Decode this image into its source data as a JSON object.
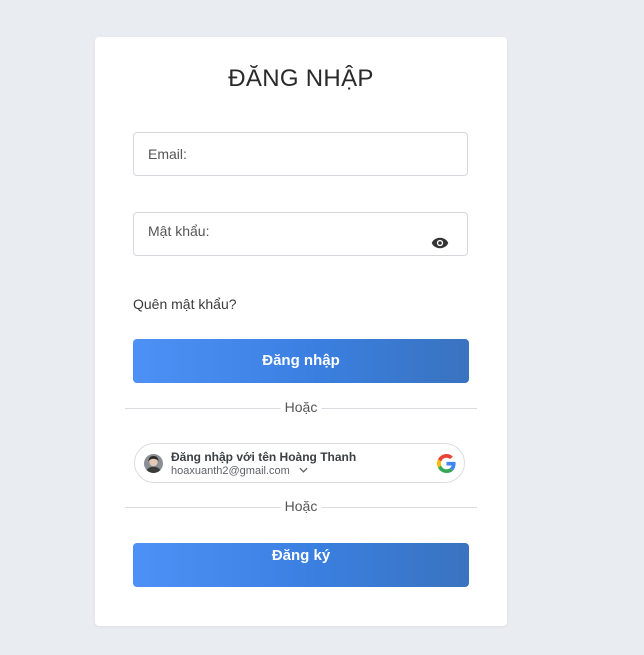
{
  "login": {
    "title": "ĐĂNG NHẬP",
    "email_placeholder": "Email:",
    "password_placeholder": "Mật khẩu:",
    "forgot_label": "Quên mật khẩu?",
    "login_button": "Đăng nhập",
    "or_label_1": "Hoặc",
    "or_label_2": "Hoặc",
    "register_button": "Đăng ký",
    "icons": {
      "password_toggle": "eye-icon",
      "google": "google-logo-icon",
      "avatar": "user-avatar",
      "account_chooser": "chevron-down-icon"
    }
  },
  "google_signin": {
    "label": "Đăng nhập với tên Hoàng Thanh",
    "email": "hoaxuanth2@gmail.com"
  },
  "colors": {
    "background": "#e9ecf0",
    "card": "#ffffff",
    "button_gradient_start": "#4e91f6",
    "button_gradient_end": "#3a73bf",
    "google_blue": "#4285F4",
    "google_red": "#EA4335",
    "google_yellow": "#FBBC05",
    "google_green": "#34A853"
  }
}
